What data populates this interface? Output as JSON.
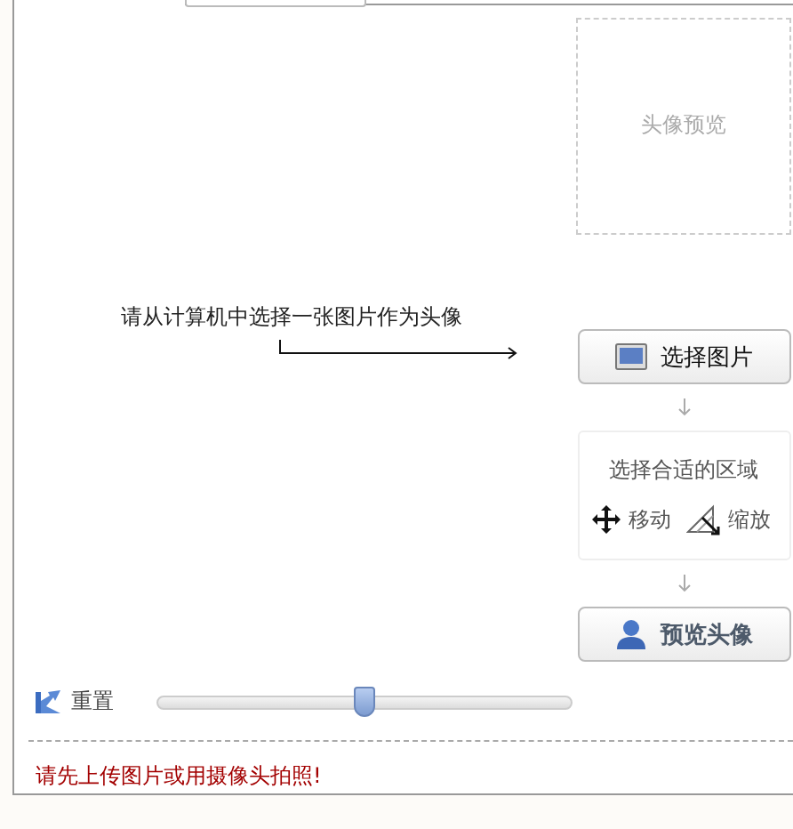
{
  "preview": {
    "label": "头像预览"
  },
  "instruction": "请从计算机中选择一张图片作为头像",
  "select_button": {
    "label": "选择图片"
  },
  "crop_step": {
    "title": "选择合适的区域",
    "tools": [
      {
        "kind": "move",
        "label": "移动"
      },
      {
        "kind": "scale",
        "label": "缩放"
      }
    ]
  },
  "preview_button": {
    "label": "预览头像"
  },
  "reset": {
    "label": "重置"
  },
  "zoom_slider": {
    "level": 0.5
  },
  "error_message": "请先上传图片或用摄像头拍照!"
}
